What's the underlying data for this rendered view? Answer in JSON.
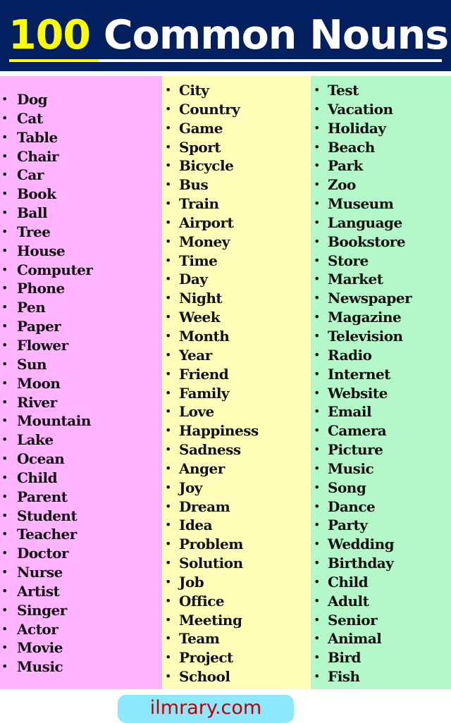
{
  "header": {
    "title_number": "100",
    "title_rest": " Common Nouns",
    "colors": {
      "background": "#02205f",
      "number": "#ffff00",
      "text": "#ffffff"
    }
  },
  "columns": [
    {
      "color": "#ffb4ff",
      "items": [
        "Dog",
        "Cat",
        "Table",
        "Chair",
        "Car",
        "Book",
        "Ball",
        "Tree",
        "House",
        "Computer",
        "Phone",
        "Pen",
        "Paper",
        "Flower",
        "Sun",
        "Moon",
        "River",
        "Mountain",
        "Lake",
        "Ocean",
        "Child",
        "Parent",
        "Student",
        "Teacher",
        "Doctor",
        "Nurse",
        "Artist",
        "Singer",
        "Actor",
        "Movie",
        "Music"
      ]
    },
    {
      "color": "#ffffb9",
      "items": [
        "City",
        "Country",
        "Game",
        "Sport",
        "Bicycle",
        "Bus",
        "Train",
        "Airport",
        "Money",
        "Time",
        "Day",
        "Night",
        "Week",
        "Month",
        "Year",
        "Friend",
        "Family",
        "Love",
        "Happiness",
        "Sadness",
        "Anger",
        "Joy",
        "Dream",
        "Idea",
        "Problem",
        "Solution",
        "Job",
        "Office",
        "Meeting",
        "Team",
        "Project",
        "School"
      ]
    },
    {
      "color": "#b4f7c9",
      "items": [
        "Test",
        "Vacation",
        "Holiday",
        "Beach",
        "Park",
        "Zoo",
        "Museum",
        "Language",
        "Bookstore",
        "Store",
        "Market",
        "Newspaper",
        "Magazine",
        "Television",
        "Radio",
        "Internet",
        "Website",
        "Email",
        "Camera",
        "Picture",
        "Music",
        "Song",
        "Dance",
        "Party",
        "Wedding",
        "Birthday",
        "Child",
        "Adult",
        "Senior",
        "Animal",
        "Bird",
        "Fish"
      ]
    }
  ],
  "bullet_glyph": "•",
  "footer": {
    "site": "ilmrary.com",
    "colors": {
      "background": "#8ee8fd",
      "text": "#c00000"
    }
  }
}
